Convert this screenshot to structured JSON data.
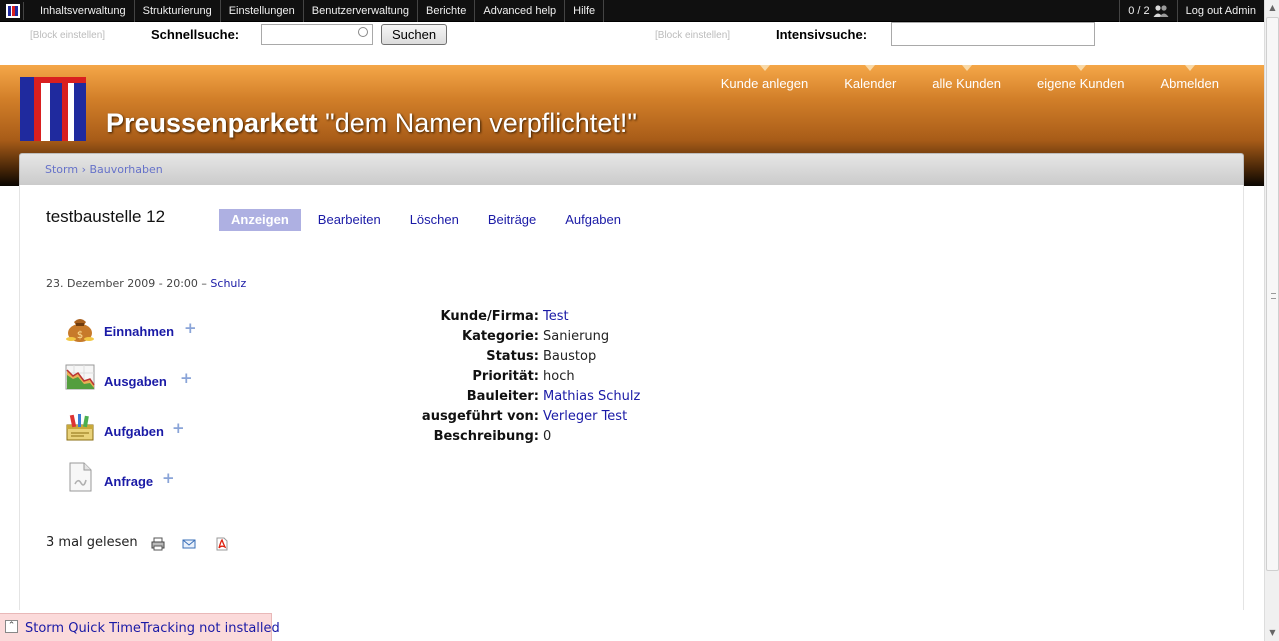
{
  "admin_bar": {
    "menu": [
      "Inhaltsverwaltung",
      "Strukturierung",
      "Einstellungen",
      "Benutzerverwaltung",
      "Berichte",
      "Advanced help",
      "Hilfe"
    ],
    "user_count": "0 / 2",
    "logout": "Log out Admin"
  },
  "search": {
    "block_quick": "[Block einstellen]",
    "quick_label": "Schnellsuche:",
    "quick_value": "",
    "button": "Suchen",
    "block_intensive": "[Block einstellen]",
    "intensive_label": "Intensivsuche:",
    "intensive_value": ""
  },
  "header": {
    "site_name": "Preussenparkett",
    "slogan": "\"dem Namen verpflichtet!\"",
    "nav": [
      "Kunde anlegen",
      "Kalender",
      "alle Kunden",
      "eigene Kunden",
      "Abmelden"
    ],
    "colors": {
      "orange_top": "#f5a748",
      "brown_bottom": "#0a0602",
      "logo_red": "#d91f1f",
      "logo_blue": "#1f2a9e"
    }
  },
  "breadcrumb": {
    "home": "Storm",
    "sep": "›",
    "current": "Bauvorhaben"
  },
  "page": {
    "title": "testbaustelle 12",
    "tabs": [
      "Anzeigen",
      "Bearbeiten",
      "Löschen",
      "Beiträge",
      "Aufgaben"
    ],
    "submitted": "23. Dezember 2009 - 20:00 –",
    "author": "Schulz"
  },
  "sidebar": [
    {
      "label": "Einnahmen",
      "icon": "money-bag-icon"
    },
    {
      "label": "Ausgaben",
      "icon": "chart-icon"
    },
    {
      "label": "Aufgaben",
      "icon": "tasks-icon"
    },
    {
      "label": "Anfrage",
      "icon": "document-icon"
    }
  ],
  "fields": [
    {
      "key": "Kunde/Firma:",
      "value": "Test"
    },
    {
      "key": "Kategorie:",
      "value": "Sanierung"
    },
    {
      "key": "Status:",
      "value": "Baustop"
    },
    {
      "key": "Priorität:",
      "value": "hoch"
    },
    {
      "key": "Bauleiter:",
      "value": "Mathias Schulz"
    },
    {
      "key": "ausgeführt von:",
      "value": "Verleger Test"
    },
    {
      "key": "Beschreibung:",
      "value": "0"
    }
  ],
  "read_count": "3 mal gelesen",
  "footer": {
    "timetracking": "Storm Quick TimeTracking not installed"
  }
}
